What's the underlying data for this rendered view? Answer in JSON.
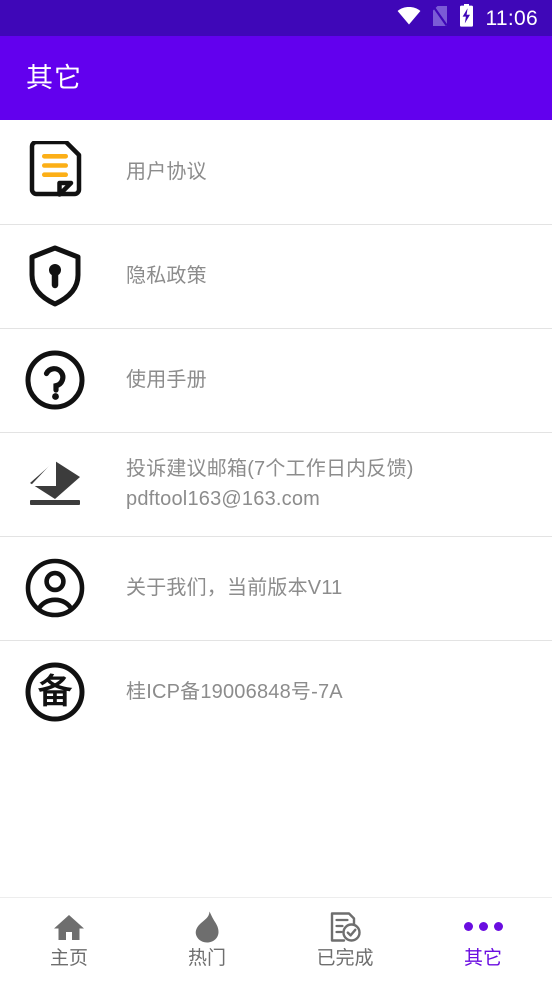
{
  "status_bar": {
    "background": "#3F07B8",
    "time": "11:06",
    "icons": [
      "wifi-icon",
      "no-sim-icon",
      "battery-charging-icon"
    ]
  },
  "app_bar": {
    "title": "其它",
    "background": "#6200EE",
    "text_color": "#FFFFFF"
  },
  "list": {
    "items": [
      {
        "icon": "document-agreement-icon",
        "label": "用户协议",
        "label2": ""
      },
      {
        "icon": "shield-lock-icon",
        "label": "隐私政策",
        "label2": ""
      },
      {
        "icon": "question-circle-icon",
        "label": "使用手册",
        "label2": ""
      },
      {
        "icon": "mail-envelope-icon",
        "label": "投诉建议邮箱(7个工作日内反馈)",
        "label2": "pdftool163@163.com"
      },
      {
        "icon": "user-circle-icon",
        "label": "关于我们，当前版本V11",
        "label2": ""
      },
      {
        "icon": "icp-beian-icon",
        "label": "桂ICP备19006848号-7A",
        "label2": ""
      }
    ],
    "text_color": "#8C8C8C",
    "divider_color": "#E3E3E3"
  },
  "bottom_nav": {
    "active_color": "#6A0DE0",
    "inactive_color": "#6E6E6E",
    "items": [
      {
        "icon": "home-icon",
        "label": "主页",
        "active": false
      },
      {
        "icon": "flame-icon",
        "label": "热门",
        "active": false
      },
      {
        "icon": "doc-check-icon",
        "label": "已完成",
        "active": false
      },
      {
        "icon": "more-dots-icon",
        "label": "其它",
        "active": true
      }
    ]
  }
}
